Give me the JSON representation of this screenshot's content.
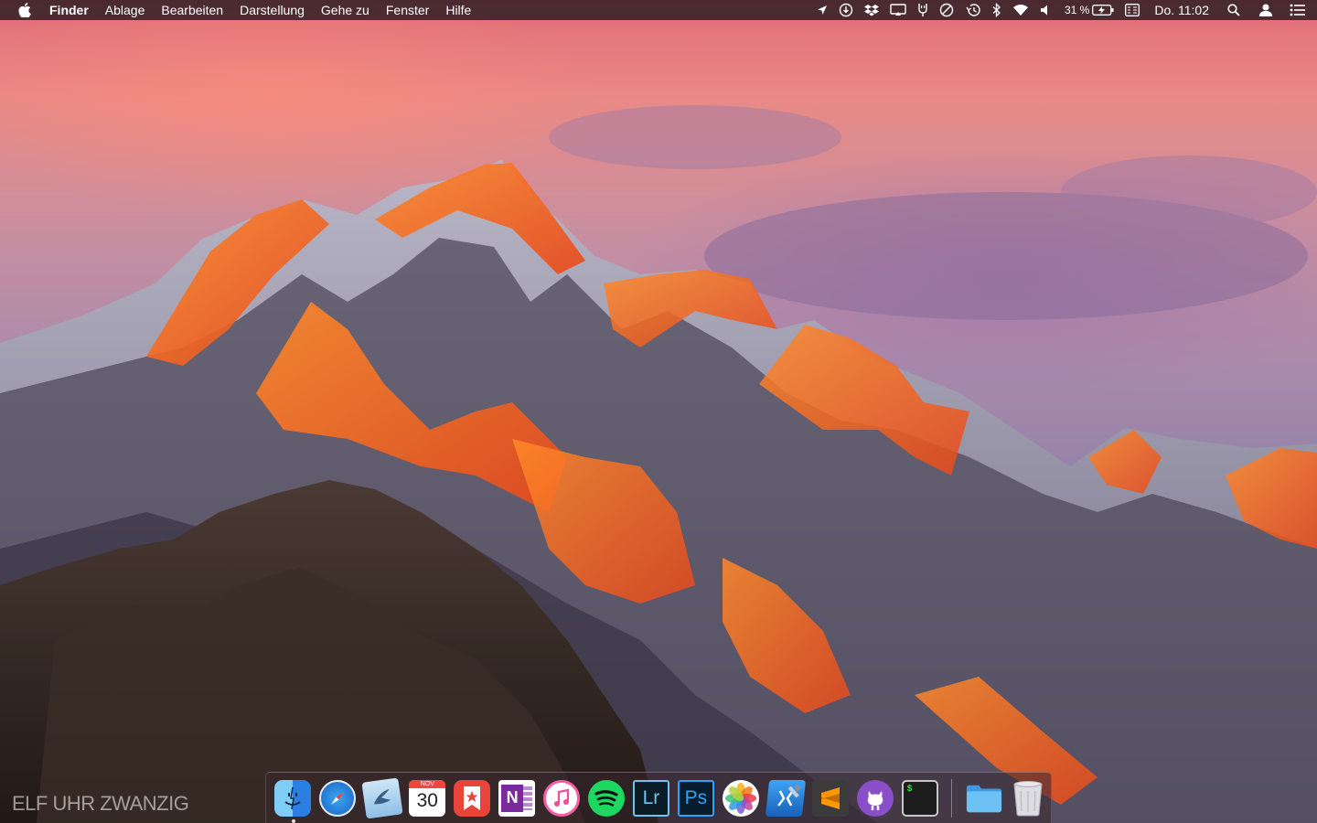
{
  "menubar": {
    "app_name": "Finder",
    "menus": [
      "Ablage",
      "Bearbeiten",
      "Darstellung",
      "Gehe zu",
      "Fenster",
      "Hilfe"
    ],
    "battery_text": "31 %",
    "clock": "Do. 11:02",
    "status_icons": [
      "location-arrow-icon",
      "app-store-icon",
      "dropbox-icon",
      "airplay-icon",
      "usb-icon",
      "do-not-disturb-icon",
      "time-machine-icon",
      "bluetooth-icon",
      "wifi-icon",
      "volume-icon",
      "battery-icon",
      "input-menu-icon",
      "spotlight-icon",
      "user-icon",
      "notification-center-icon"
    ]
  },
  "desktop": {
    "widget_text": "ELF UHR ZWANZIG"
  },
  "dock": {
    "apps": [
      {
        "name": "Finder",
        "icon": "finder-icon",
        "running": true
      },
      {
        "name": "Safari",
        "icon": "safari-icon",
        "running": false
      },
      {
        "name": "Mail",
        "icon": "mail-icon",
        "running": false
      },
      {
        "name": "Kalender",
        "icon": "calendar-icon",
        "running": false,
        "month": "NOV",
        "day": "30"
      },
      {
        "name": "Wunderlist",
        "icon": "wunderlist-icon",
        "running": false
      },
      {
        "name": "OneNote",
        "icon": "onenote-icon",
        "running": false,
        "glyph": "N"
      },
      {
        "name": "iTunes",
        "icon": "itunes-icon",
        "running": false
      },
      {
        "name": "Spotify",
        "icon": "spotify-icon",
        "running": false
      },
      {
        "name": "Lightroom",
        "icon": "lightroom-icon",
        "running": false,
        "glyph": "Lr"
      },
      {
        "name": "Photoshop",
        "icon": "photoshop-icon",
        "running": false,
        "glyph": "Ps"
      },
      {
        "name": "Fotos",
        "icon": "photos-icon",
        "running": false
      },
      {
        "name": "Xcode",
        "icon": "xcode-icon",
        "running": false
      },
      {
        "name": "Sublime Text",
        "icon": "sublime-icon",
        "running": false
      },
      {
        "name": "GitHub Desktop",
        "icon": "github-icon",
        "running": false
      },
      {
        "name": "Terminal",
        "icon": "terminal-icon",
        "running": false,
        "glyph": "$"
      }
    ],
    "stack": {
      "name": "Dokumente",
      "icon": "folder-icon"
    },
    "trash": {
      "name": "Papierkorb",
      "icon": "trash-icon"
    }
  },
  "colors": {
    "menubar_bg": "#281c20",
    "dock_bg": "#37262d",
    "peak_light": "#ff6a1a",
    "rock_dark": "#2f2420"
  }
}
